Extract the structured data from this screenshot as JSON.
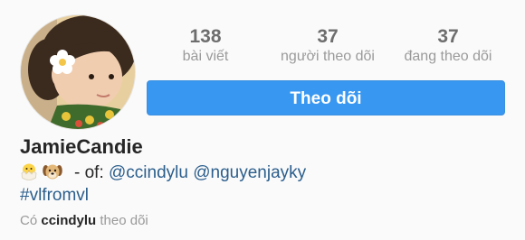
{
  "stats": {
    "posts": {
      "value": "138",
      "label": "bài viết"
    },
    "followers": {
      "value": "37",
      "label": "người theo dõi"
    },
    "following": {
      "value": "37",
      "label": "đang theo dõi"
    }
  },
  "follow_button": {
    "label": "Theo dõi"
  },
  "profile": {
    "username": "JamieCandie",
    "bio": {
      "emoji": [
        "hatching-chick-icon",
        "dog-face-icon"
      ],
      "prefix": "- of:",
      "mentions": [
        "@ccindylu",
        "@nguyenjayky"
      ],
      "hashtag": "#vlfromvl"
    },
    "followed_by": {
      "prefix": "Có",
      "name": "ccindylu",
      "suffix": "theo dõi"
    }
  },
  "colors": {
    "accent": "#3897f0",
    "link": "#2b5e8c",
    "muted": "#999999",
    "text": "#262626"
  }
}
